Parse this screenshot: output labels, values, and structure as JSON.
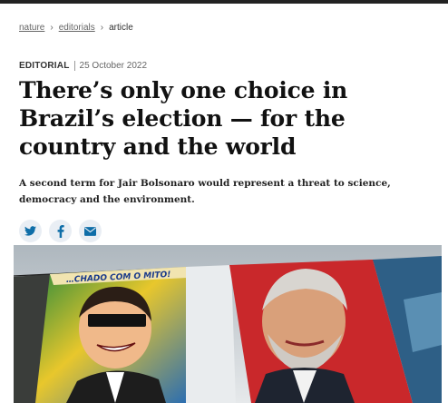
{
  "breadcrumb": {
    "items": [
      "nature",
      "editorials"
    ],
    "current": "article",
    "separator": "›"
  },
  "article": {
    "type": "EDITORIAL",
    "date": "25 October 2022",
    "title": "There’s only one choice in Brazil’s election — for the country and the world",
    "standfirst": "A second term for Jair Bolsonaro would represent a threat to science, democracy and the environment."
  },
  "share": {
    "buttons": [
      "twitter-icon",
      "facebook-icon",
      "email-icon"
    ],
    "accent": "#0f6ea8"
  },
  "hero": {
    "banner_text": "…CHADO COM O MITO!"
  }
}
